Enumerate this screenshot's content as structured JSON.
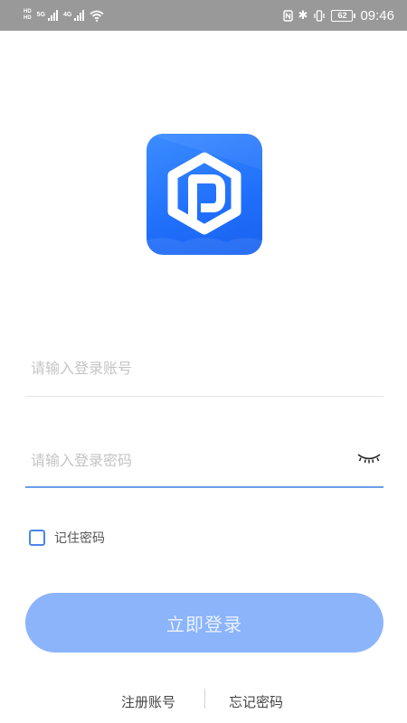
{
  "status_bar": {
    "network_top": "HD",
    "network_bottom": "HD",
    "sim1_tag": "5G",
    "sim2_tag": "4G",
    "battery": "62",
    "time": "09:46"
  },
  "login": {
    "account_placeholder": "请输入登录账号",
    "password_placeholder": "请输入登录密码",
    "remember_label": "记住密码",
    "remember_checked": false,
    "submit_label": "立即登录"
  },
  "links": {
    "register": "注册账号",
    "forgot": "忘记密码"
  },
  "colors": {
    "brand_blue": "#1f6ffb",
    "button_disabled": "#8bb4fb",
    "focus_line": "#6a9ee8",
    "status_bar": "#999999"
  },
  "icons": {
    "logo": "hexagon-p-logo-icon",
    "password_visibility": "eye-closed-icon"
  }
}
